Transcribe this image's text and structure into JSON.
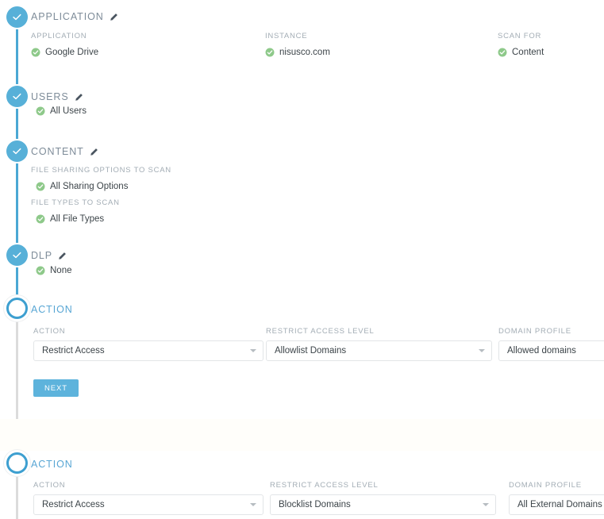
{
  "steps": [
    {
      "id": "application",
      "state": "done",
      "title": "APPLICATION",
      "edit_icon": "pencil-icon",
      "columns": [
        {
          "label": "APPLICATION",
          "value": "Google Drive",
          "icon": "green-check-icon"
        },
        {
          "label": "INSTANCE",
          "value": "nisusco.com",
          "icon": "green-check-icon"
        },
        {
          "label": "SCAN FOR",
          "value": "Content",
          "icon": "green-check-icon"
        }
      ]
    },
    {
      "id": "users",
      "state": "done",
      "title": "USERS",
      "edit_icon": "pencil-icon",
      "columns": [
        {
          "label": "",
          "value": "All Users",
          "icon": "green-check-icon"
        }
      ]
    },
    {
      "id": "content",
      "state": "done",
      "title": "CONTENT",
      "edit_icon": "pencil-icon",
      "columns": [
        {
          "label": "FILE SHARING OPTIONS TO SCAN",
          "value": "All Sharing Options",
          "icon": "green-check-icon"
        },
        {
          "label": "FILE TYPES TO SCAN",
          "value": "All File Types",
          "icon": "green-check-icon"
        }
      ]
    },
    {
      "id": "dlp",
      "state": "done",
      "title": "DLP",
      "edit_icon": "pencil-icon",
      "columns": [
        {
          "label": "",
          "value": "None",
          "icon": "green-check-icon"
        }
      ]
    }
  ],
  "action_step_1": {
    "state": "open",
    "title": "ACTION",
    "fields": [
      {
        "label": "ACTION",
        "value": "Restrict Access",
        "control": "dropdown"
      },
      {
        "label": "RESTRICT ACCESS LEVEL",
        "value": "Allowlist Domains",
        "control": "dropdown"
      },
      {
        "label": "DOMAIN PROFILE",
        "value": "Allowed domains",
        "control": "dropdown"
      }
    ],
    "next_label": "NEXT"
  },
  "action_step_2": {
    "state": "open",
    "title": "ACTION",
    "fields": [
      {
        "label": "ACTION",
        "value": "Restrict Access",
        "control": "dropdown"
      },
      {
        "label": "RESTRICT ACCESS LEVEL",
        "value": "Blocklist Domains",
        "control": "dropdown"
      },
      {
        "label": "DOMAIN PROFILE",
        "value": "All External Domains",
        "control": "dropdown"
      }
    ]
  },
  "colors": {
    "rail_active": "#4ba8d4",
    "rail_inactive": "#dcdcdc",
    "node_done": "#57b0d8",
    "node_open_ring": "#3d9fd0",
    "accent": "#58a6d4",
    "green_check": "#8ec98a",
    "label_text": "#a3adb5",
    "value_text": "#3c4449",
    "button": "#5db3dc"
  }
}
